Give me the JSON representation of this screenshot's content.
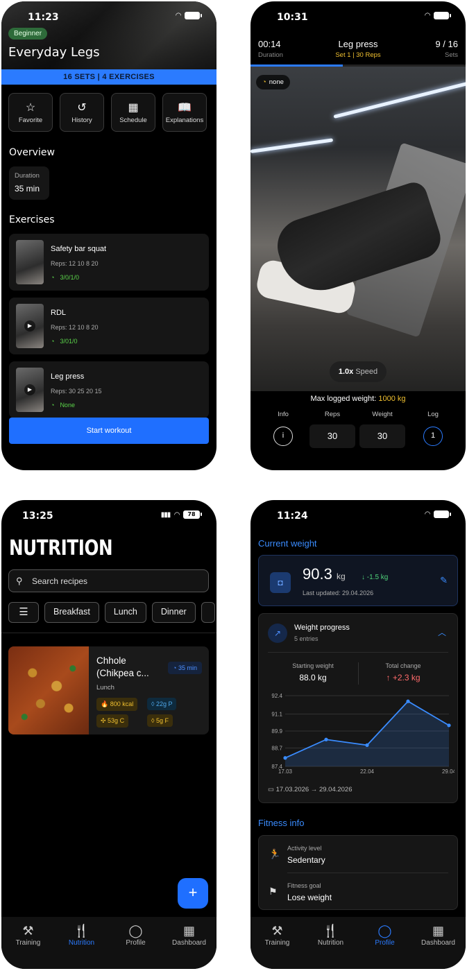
{
  "phone1": {
    "status": {
      "time": "11:23"
    },
    "level_badge": "Beginner",
    "title": "Everyday Legs",
    "sets_bar": "16 SETS | 4 EXERCISES",
    "actions": [
      {
        "label": "Favorite",
        "icon": "star-icon"
      },
      {
        "label": "History",
        "icon": "history-icon"
      },
      {
        "label": "Schedule",
        "icon": "calendar-icon"
      },
      {
        "label": "Explanations",
        "icon": "book-icon"
      }
    ],
    "overview_title": "Overview",
    "duration_label": "Duration",
    "duration_value": "35 min",
    "exercises_title": "Exercises",
    "exercises": [
      {
        "name": "Safety bar squat",
        "reps": "Reps: 12  10  8  20",
        "tempo": "3/0/1/0"
      },
      {
        "name": "RDL",
        "reps": "Reps: 12  10  8  20",
        "tempo": "3/01/0"
      },
      {
        "name": "Leg press",
        "reps": "Reps: 30  25  20  15",
        "tempo": "None"
      }
    ],
    "start_button": "Start workout"
  },
  "phone2": {
    "status": {
      "time": "10:31"
    },
    "elapsed": "00:14",
    "elapsed_label": "Duration",
    "exercise": "Leg press",
    "set_info": "Set 1 | 30 Reps",
    "set_progress": "9 / 16",
    "set_progress_label": "Sets",
    "progress_fraction": 0.43,
    "tempo_chip": "none",
    "speed_value": "1.0x",
    "speed_label": "Speed",
    "max_label": "Max logged weight:",
    "max_value": "1000 kg",
    "info_label": "Info",
    "reps_label": "Reps",
    "reps_value": "30",
    "weight_label": "Weight",
    "weight_value": "30",
    "log_label": "Log",
    "log_value": "1"
  },
  "phone3": {
    "status": {
      "time": "13:25",
      "battery": "78"
    },
    "title": "NUTRITION",
    "search_placeholder": "Search recipes",
    "filters": [
      "Breakfast",
      "Lunch",
      "Dinner"
    ],
    "recipe": {
      "name": "Chhole (Chikpea c...",
      "category": "Lunch",
      "time": "35 min",
      "kcal": "800 kcal",
      "protein": "22g P",
      "carbs": "53g C",
      "fat": "5g F"
    },
    "fab": "+",
    "tabs": [
      {
        "label": "Training",
        "icon": "dumbbell-icon"
      },
      {
        "label": "Nutrition",
        "icon": "utensils-icon"
      },
      {
        "label": "Profile",
        "icon": "user-icon"
      },
      {
        "label": "Dashboard",
        "icon": "dashboard-icon"
      }
    ],
    "active_tab": "Nutrition"
  },
  "phone4": {
    "status": {
      "time": "11:24"
    },
    "current_weight_title": "Current weight",
    "weight_value": "90.3",
    "weight_unit": "kg",
    "weight_delta": "↓ -1.5 kg",
    "last_updated": "Last updated: 29.04.2026",
    "progress_title": "Weight progress",
    "progress_entries": "5 entries",
    "starting_label": "Starting weight",
    "starting_value": "88.0 kg",
    "change_label": "Total change",
    "change_value": "↑ +2.3 kg",
    "date_range": "17.03.2026  →  29.04.2026",
    "fitness_title": "Fitness info",
    "activity_label": "Activity level",
    "activity_value": "Sedentary",
    "goal_label": "Fitness goal",
    "goal_value": "Lose weight",
    "tabs": [
      {
        "label": "Training",
        "icon": "dumbbell-icon"
      },
      {
        "label": "Nutrition",
        "icon": "utensils-icon"
      },
      {
        "label": "Profile",
        "icon": "user-icon"
      },
      {
        "label": "Dashboard",
        "icon": "dashboard-icon"
      }
    ],
    "active_tab": "Profile",
    "accent": "#2b7bff"
  },
  "chart_data": {
    "type": "area",
    "x": [
      "17.03",
      "",
      "22.04",
      "",
      "29.04"
    ],
    "values": [
      88.0,
      89.3,
      88.9,
      92.0,
      90.3
    ],
    "y_ticks": [
      "92.4",
      "91.1",
      "89.9",
      "88.7",
      "87.4"
    ],
    "x_ticks": [
      "17.03",
      "22.04",
      "29.04"
    ],
    "ylim": [
      87.4,
      92.4
    ],
    "color": "#3a8cff",
    "grid": true
  }
}
